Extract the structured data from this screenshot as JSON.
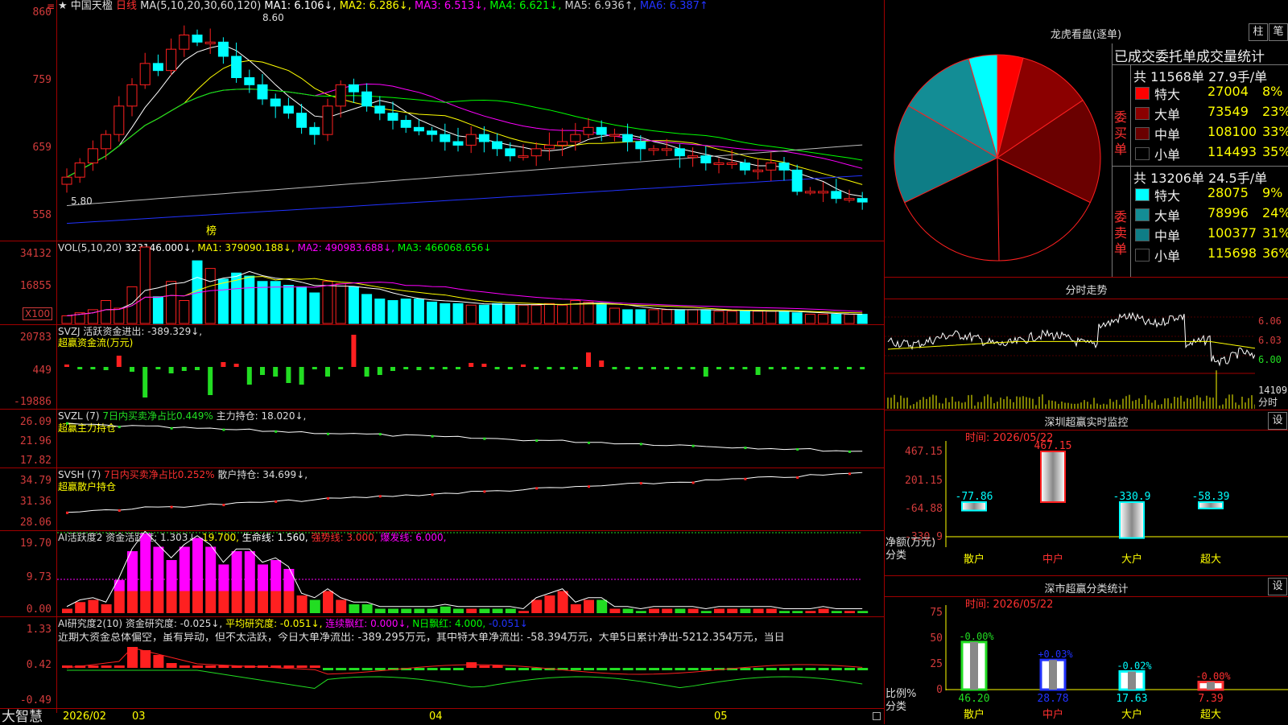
{
  "stock": {
    "star": "★",
    "name": "中国天楹",
    "period": "日线",
    "red_mark": "≡"
  },
  "ma_line": [
    {
      "t": "MA(5,10,20,30,60,120)",
      "c": "#dddddd"
    },
    {
      "t": "MA1: 6.106↓,",
      "c": "#ffffff"
    },
    {
      "t": "MA2: 6.286↓,",
      "c": "#ffff00"
    },
    {
      "t": "MA3: 6.513↓,",
      "c": "#ff00ff"
    },
    {
      "t": "MA4: 6.621↓,",
      "c": "#00ff00"
    },
    {
      "t": "MA5: 6.936↑,",
      "c": "#cccccc"
    },
    {
      "t": "MA6: 6.387↑",
      "c": "#2233ff"
    }
  ],
  "price_axis": [
    "860",
    "759",
    "659",
    "558"
  ],
  "price_high_label": "8.60",
  "price_low_label": "5.80",
  "bang_label": "榜",
  "vol_line": [
    {
      "t": "VOL(5,10,20)",
      "c": "#dddddd"
    },
    {
      "t": "323146.000↓,",
      "c": "#ffffff"
    },
    {
      "t": "MA1: 379090.188↓,",
      "c": "#ffff00"
    },
    {
      "t": "MA2: 490983.688↓,",
      "c": "#ff00ff"
    },
    {
      "t": "MA3: 466068.656↓",
      "c": "#00ff00"
    }
  ],
  "vol_axis": [
    "34132",
    "16855",
    "X100"
  ],
  "svzj": {
    "l1": "SVZJ  活跃资金进出: -389.329↓,",
    "l2": "超赢资金流(万元)",
    "axis": [
      "20783",
      "449",
      "-19886"
    ]
  },
  "svzl": {
    "l1a": "SVZL (7)",
    "l1b": "7日内买卖净占比0.449%",
    "l1c": "主力持仓: 18.020↓,",
    "l2": "超赢主力持仓",
    "axis": [
      "26.09",
      "21.96",
      "17.82"
    ]
  },
  "svsh": {
    "l1a": "SVSH (7)",
    "l1b": "7日内买卖净占比0.252%",
    "l1c": "散户持仓: 34.699↓,",
    "l2": "超赢散户持仓",
    "axis": [
      "34.79",
      "31.36",
      "28.06"
    ]
  },
  "ai1": {
    "parts": [
      {
        "t": "AI活跃度2 资金活跃度: 1.303↓,",
        "c": "#dddddd"
      },
      {
        "t": "19.700,",
        "c": "#ffff00"
      },
      {
        "t": "生命线: 1.560,",
        "c": "#ffffff"
      },
      {
        "t": "强势线: 3.000,",
        "c": "#ff3030"
      },
      {
        "t": "爆发线: 6.000,",
        "c": "#ff00ff"
      }
    ],
    "axis": [
      "19.70",
      "9.73",
      "0.00"
    ]
  },
  "ai2": {
    "parts": [
      {
        "t": "AI研究度2(10) 资金研究度: -0.025↓,",
        "c": "#dddddd"
      },
      {
        "t": "平均研究度: -0.051↓,",
        "c": "#ffff00"
      },
      {
        "t": "连续飘红: 0.000↓,",
        "c": "#ff00ff"
      },
      {
        "t": "N日飘红: 4.000,",
        "c": "#00ff00"
      },
      {
        "t": "-0.051↓",
        "c": "#2233ff"
      }
    ],
    "desc": "近期大资金总体偏空，虽有异动，但不太活跃，今日大单净流出: -389.295万元，其中特大单净流出: -58.394万元，大单5日累计净出-5212.354万元，当日",
    "axis": [
      "1.33",
      "0.42",
      "-0.49"
    ]
  },
  "bottom": {
    "logo": "大智慧",
    "dates": [
      "2026/02",
      "03",
      "04",
      "05"
    ]
  },
  "longhu": {
    "title": "龙虎看盘(逐单)",
    "btn1": "柱",
    "btn2": "笔",
    "header": "已成交委托单成交量统计",
    "buy_label": "委买单",
    "sell_label": "委卖单",
    "buy_total": "共 11568单 27.9手/单",
    "sell_total": "共 13206单 24.5手/单",
    "buy_rows": [
      {
        "name": "特大",
        "val": "27004",
        "pct": "8%",
        "color": "#ff0000",
        "share": 8
      },
      {
        "name": "大单",
        "val": "73549",
        "pct": "23%",
        "color": "#8b0000",
        "share": 23
      },
      {
        "name": "中单",
        "val": "108100",
        "pct": "33%",
        "color": "#6a0000",
        "share": 33
      },
      {
        "name": "小单",
        "val": "114493",
        "pct": "35%",
        "color": "#000000",
        "share": 35
      }
    ],
    "sell_rows": [
      {
        "name": "特大",
        "val": "28075",
        "pct": "9%",
        "color": "#00ffff",
        "share": 9
      },
      {
        "name": "大单",
        "val": "78996",
        "pct": "24%",
        "color": "#138d95",
        "share": 24
      },
      {
        "name": "中单",
        "val": "100377",
        "pct": "31%",
        "color": "#0e7d86",
        "share": 31
      },
      {
        "name": "小单",
        "val": "115698",
        "pct": "36%",
        "color": "#000000",
        "share": 36
      }
    ]
  },
  "fenshi": {
    "title": "分时走势",
    "axis": [
      "6.06",
      "6.03",
      "6.00"
    ],
    "vol": "14109",
    "unit": "分时"
  },
  "sz_monitor": {
    "title": "深圳超赢实时监控",
    "btn": "设",
    "time": "时间: 2026/05/22",
    "axis": [
      "467.15",
      "201.15",
      "-64.88",
      "-330.9"
    ],
    "ylabel": "净额(万元)",
    "xlabel": "分类",
    "cats": [
      "散户",
      "中户",
      "大户",
      "超大"
    ],
    "values": [
      -77.86,
      467.15,
      -330.9,
      -58.39
    ],
    "labels": [
      "-77.86",
      "467.15",
      "-330.9",
      "-58.39"
    ]
  },
  "sz_class": {
    "title": "深市超赢分类统计",
    "btn": "设",
    "time": "时间: 2026/05/22",
    "axis": [
      "75",
      "50",
      "25",
      "0"
    ],
    "ylabel": "比例%",
    "xlabel": "分类",
    "cats": [
      "散户",
      "中户",
      "大户",
      "超大"
    ],
    "values": [
      46.2,
      28.78,
      17.63,
      7.39
    ],
    "labels": [
      "46.20",
      "28.78",
      "17.63",
      "7.39"
    ],
    "changes": [
      "-0.00%",
      "+0.03%",
      "-0.02%",
      "-0.00%"
    ],
    "colors": [
      "#22dd22",
      "#2233ff",
      "#00ffff",
      "#ff3030"
    ]
  }
}
